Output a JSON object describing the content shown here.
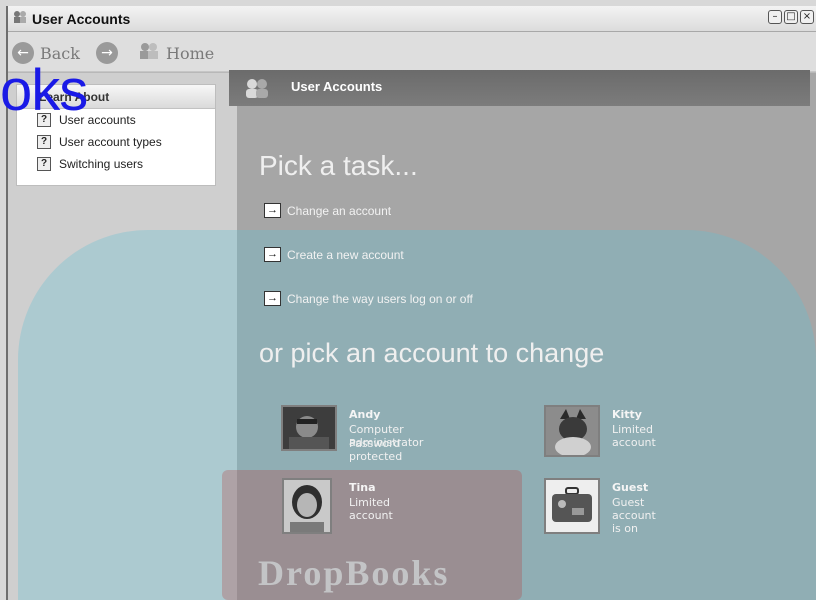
{
  "window": {
    "title": "User Accounts"
  },
  "toolbar": {
    "back_label": "Back",
    "home_label": "Home"
  },
  "learn_about": {
    "header": "Learn About",
    "items": [
      {
        "label": "User accounts"
      },
      {
        "label": "User account types"
      },
      {
        "label": "Switching users"
      }
    ]
  },
  "main": {
    "header_title": "User Accounts",
    "pick_task": "Pick a task...",
    "tasks": [
      {
        "label": "Change an account"
      },
      {
        "label": "Create a new account"
      },
      {
        "label": "Change the way users log on or off"
      }
    ],
    "pick_account": "or pick an account to change",
    "accounts": [
      {
        "name": "Andy",
        "line1": "Computer administrator",
        "line2": "Password protected"
      },
      {
        "name": "Kitty",
        "line1": "Limited account",
        "line2": ""
      },
      {
        "name": "Tina",
        "line1": "Limited account",
        "line2": ""
      },
      {
        "name": "Guest",
        "line1": "Guest account is on",
        "line2": ""
      }
    ]
  },
  "watermark": {
    "logo": "oks",
    "brand": "DropBooks"
  },
  "icons": {
    "window": "user-accounts-icon",
    "back": "back-arrow-icon",
    "forward": "forward-arrow-icon",
    "home": "home-icon",
    "help": "help-question-icon",
    "task": "arrow-right-icon",
    "header": "people-icon"
  },
  "colors": {
    "accent": "#6b6b6b",
    "watermark_blue": "#64bed2",
    "logo_blue": "#1a1ae6"
  }
}
